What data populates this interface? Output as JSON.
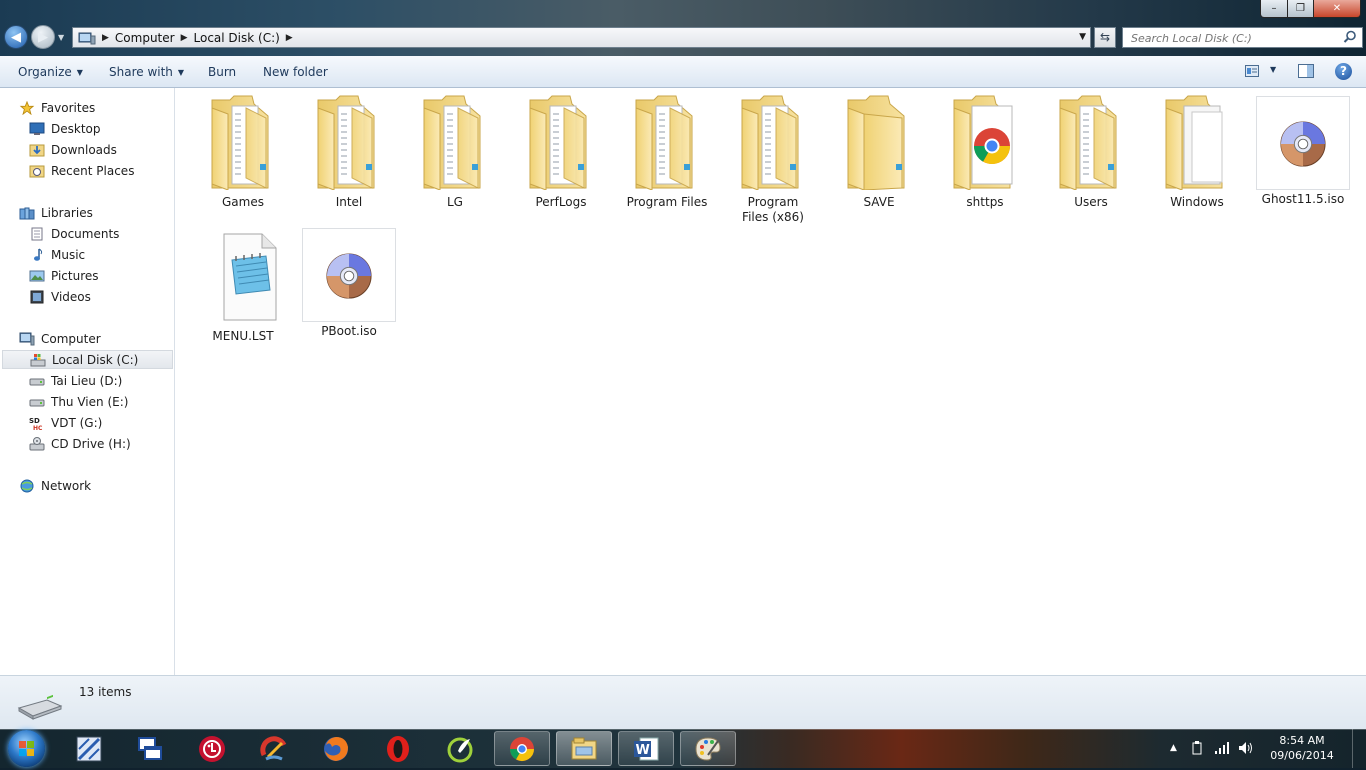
{
  "window": {
    "breadcrumb": [
      "Computer",
      "Local Disk (C:)"
    ],
    "search_placeholder": "Search Local Disk (C:)",
    "buttons": {
      "minimize": "–",
      "maximize": "❐",
      "close": "✕"
    }
  },
  "toolbar": {
    "organize": "Organize",
    "share_with": "Share with",
    "burn": "Burn",
    "new_folder": "New folder",
    "help": "?"
  },
  "nav": {
    "favorites": {
      "label": "Favorites",
      "items": [
        "Desktop",
        "Downloads",
        "Recent Places"
      ]
    },
    "libraries": {
      "label": "Libraries",
      "items": [
        "Documents",
        "Music",
        "Pictures",
        "Videos"
      ]
    },
    "computer": {
      "label": "Computer",
      "items": [
        "Local Disk (C:)",
        "Tai Lieu (D:)",
        "Thu Vien (E:)",
        "VDT (G:)",
        "CD Drive (H:)"
      ],
      "selected": "Local Disk (C:)"
    },
    "network": {
      "label": "Network"
    }
  },
  "files": {
    "games": "Games",
    "intel": "Intel",
    "lg": "LG",
    "perflogs": "PerfLogs",
    "program_files": "Program Files",
    "program_files_x86": "Program Files (x86)",
    "save": "SAVE",
    "shttps": "shttps",
    "users": "Users",
    "windows": "Windows",
    "ghost_iso": "Ghost11.5.iso",
    "menu_lst": "MENU.LST",
    "pboot_iso": "PBoot.iso"
  },
  "status": {
    "item_count": "13 items"
  },
  "taskbar": {
    "time": "8:54 AM",
    "date": "09/06/2014"
  },
  "colors": {
    "accent": "#1e395b",
    "selection": "#e3e7ec",
    "folder": "#f1d686"
  }
}
